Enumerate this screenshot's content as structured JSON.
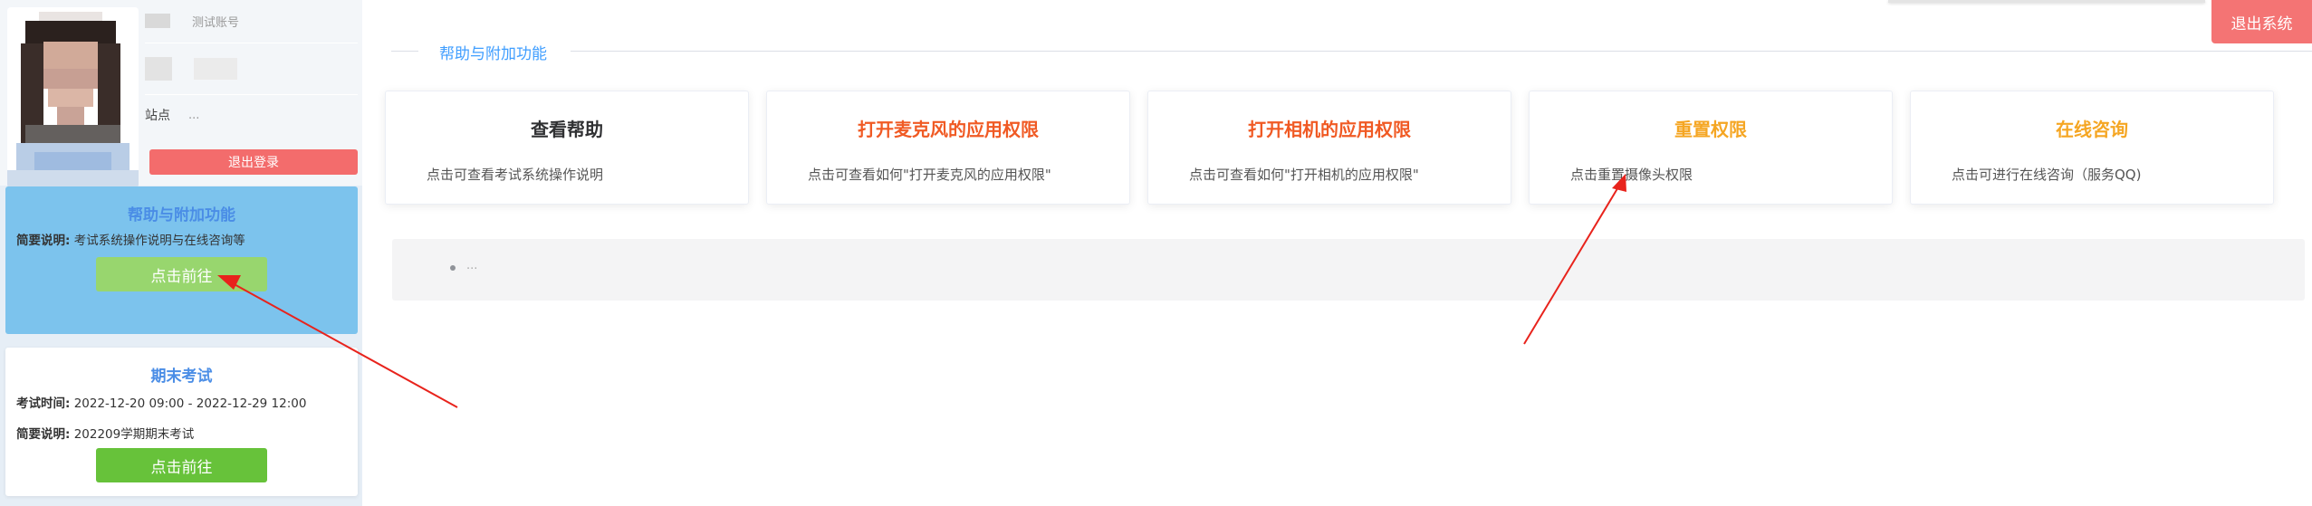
{
  "sidebar": {
    "account_label_value": "测试账号",
    "station_label": "站点",
    "station_value": "...",
    "logout_label": "退出登录",
    "help_card": {
      "title": "帮助与附加功能",
      "summary_label": "简要说明:",
      "summary_value": "考试系统操作说明与在线咨询等",
      "button_label": "点击前往"
    },
    "exam_card": {
      "title": "期末考试",
      "time_label": "考试时间:",
      "time_value": "2022-12-20 09:00 - 2022-12-29 12:00",
      "summary_label": "简要说明:",
      "summary_value": "202209学期期末考试",
      "button_label": "点击前往"
    }
  },
  "header": {
    "exit_label": "退出系统"
  },
  "section": {
    "title": "帮助与附加功能"
  },
  "functions": [
    {
      "title": "查看帮助",
      "desc": "点击可查看考试系统操作说明",
      "color": "#303133"
    },
    {
      "title": "打开麦克风的应用权限",
      "desc": "点击可查看如何\"打开麦克风的应用权限\"",
      "color": "#f05a24"
    },
    {
      "title": "打开相机的应用权限",
      "desc": "点击可查看如何\"打开相机的应用权限\"",
      "color": "#f05a24"
    },
    {
      "title": "重置权限",
      "desc": "点击重置摄像头权限",
      "color": "#f5a623"
    },
    {
      "title": "在线咨询",
      "desc": "点击可进行在线咨询（服务QQ)",
      "color": "#f5a623"
    }
  ],
  "panel": {
    "text": "..."
  },
  "colors": {
    "accent_blue": "#409eff",
    "danger_red": "#f47474",
    "success_green": "#67c23a",
    "help_card_bg": "#7cc3ed",
    "annotation_arrow": "#e8231c"
  }
}
